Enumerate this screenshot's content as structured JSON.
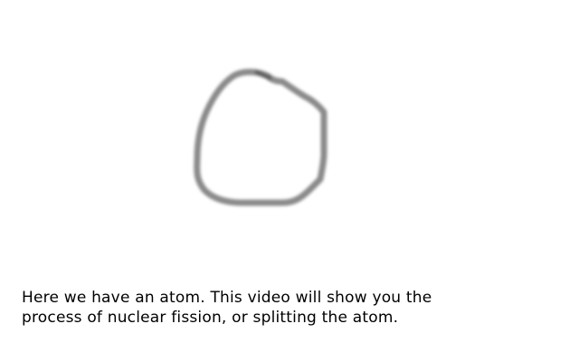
{
  "caption": {
    "line_1": "Here we have an atom. This video will show you the",
    "line_2": "process of nuclear fission, or splitting the atom."
  },
  "colors": {
    "background": "#ffffff",
    "sketch_stroke": "#8a8a8a",
    "caption_text": "#000000"
  },
  "drawing": {
    "subject": "atom-sketch"
  }
}
